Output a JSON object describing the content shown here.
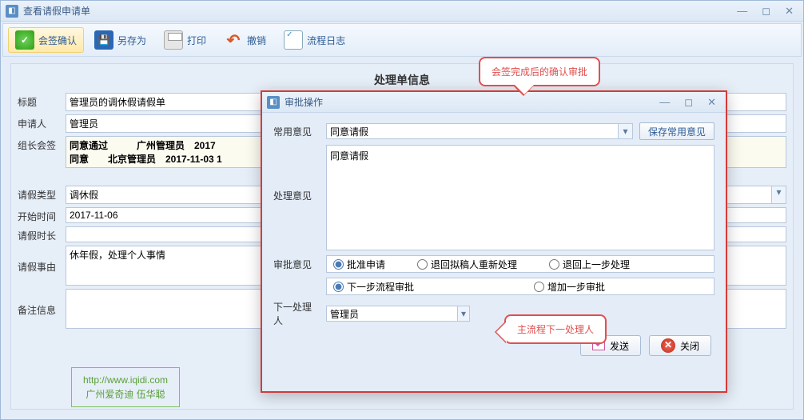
{
  "window": {
    "title": "查看请假申请单"
  },
  "toolbar": {
    "confirm": "会签确认",
    "saveAs": "另存为",
    "print": "打印",
    "undo": "撤销",
    "log": "流程日志"
  },
  "form": {
    "sectionTitle": "处理单信息",
    "labels": {
      "title": "标题",
      "applicant": "申请人",
      "countersign": "组长会签",
      "leaveType": "请假类型",
      "startTime": "开始时间",
      "duration": "请假时长",
      "reason": "请假事由",
      "remark": "备注信息"
    },
    "values": {
      "title": "管理员的调休假请假单",
      "applicant": "管理员",
      "countersign_line1": "同意通过　　　广州管理员　2017",
      "countersign_line2": "同意　　北京管理员　2017-11-03  1",
      "leaveType": "调休假",
      "startTime": "2017-11-06",
      "duration": "",
      "reason": "休年假，处理个人事情",
      "remark": ""
    }
  },
  "dialog": {
    "title": "审批操作",
    "labels": {
      "commonOpinion": "常用意见",
      "handleOpinion": "处理意见",
      "approveOpinion": "审批意见",
      "nextHandler": "下一处理人",
      "saveCommon": "保存常用意见"
    },
    "values": {
      "commonOpinion": "同意请假",
      "handleOpinion": "同意请假",
      "nextHandler": "管理员"
    },
    "radios1": {
      "approve": "批准申请",
      "returnDraft": "退回拟稿人重新处理",
      "returnPrev": "退回上一步处理"
    },
    "radios2": {
      "nextStep": "下一步流程审批",
      "addStep": "增加一步审批"
    },
    "buttons": {
      "send": "发送",
      "close": "关闭"
    }
  },
  "bubbles": {
    "b1": "会签完成后的确认审批",
    "b2": "主流程下一处理人"
  },
  "watermark": {
    "url": "http://www.iqidi.com",
    "name": "广州爱奇迪 伍华聪"
  }
}
